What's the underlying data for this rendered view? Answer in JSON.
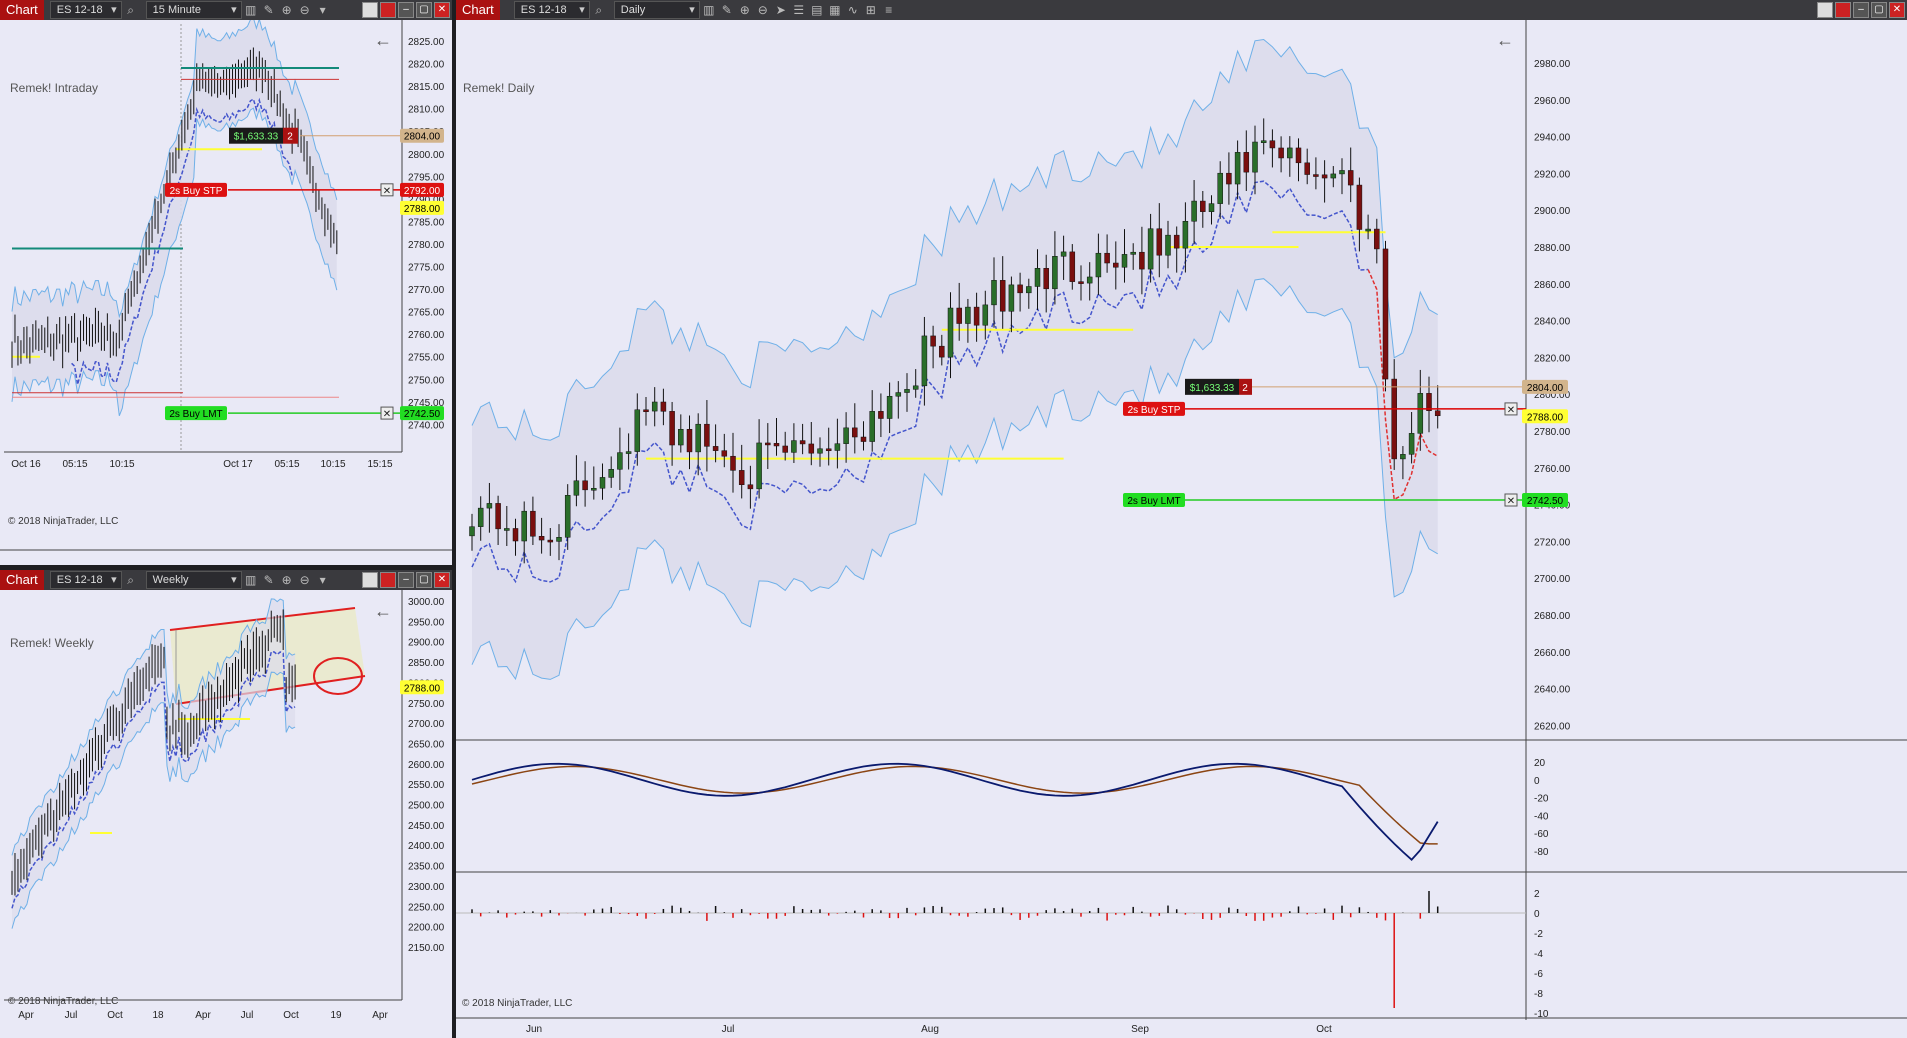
{
  "colors": {
    "down": "#7a0f0f",
    "up": "#2a6e2a",
    "band": "#6fb0e8",
    "accent_red": "#c00",
    "lmt_green": "#2c2",
    "price_tag": "#ffff33",
    "target_tag": "#d2b48c"
  },
  "common": {
    "chart_label": "Chart",
    "symbol": "ES 12-18",
    "copyright": "© 2018 NinjaTrader, LLC"
  },
  "intraday": {
    "timeframe": "15 Minute",
    "watermark": "Remek! Intraday",
    "price_labels": [
      "2825.00",
      "2820.00",
      "2815.00",
      "2810.00",
      "2805.00",
      "2800.00",
      "2795.00",
      "2790.00",
      "2785.00",
      "2780.00",
      "2775.00",
      "2770.00",
      "2765.00",
      "2760.00",
      "2755.00",
      "2750.00",
      "2745.00",
      "2740.00"
    ],
    "time_labels": [
      "Oct 16",
      "05:15",
      "10:15",
      "Oct 17",
      "05:15",
      "10:15",
      "15:15"
    ],
    "pnl": "$1,633.33",
    "pnl_qty": "2",
    "tag_target": "2804.00",
    "tag_stp": "2792.00",
    "tag_last": "2788.00",
    "tag_lmt": "2742.50",
    "buy_stp": "2s  Buy STP",
    "buy_lmt": "2s  Buy LMT"
  },
  "weekly": {
    "timeframe": "Weekly",
    "watermark": "Remek! Weekly",
    "price_labels": [
      "3000.00",
      "2950.00",
      "2900.00",
      "2850.00",
      "2800.00",
      "2750.00",
      "2700.00",
      "2650.00",
      "2600.00",
      "2550.00",
      "2500.00",
      "2450.00",
      "2400.00",
      "2350.00",
      "2300.00",
      "2250.00",
      "2200.00",
      "2150.00"
    ],
    "time_labels": [
      "Apr",
      "Jul",
      "Oct",
      "18",
      "Apr",
      "Jul",
      "Oct",
      "19",
      "Apr"
    ],
    "tag_last": "2788.00"
  },
  "daily": {
    "timeframe": "Daily",
    "watermark": "Remek! Daily",
    "price_labels": [
      "2980.00",
      "2960.00",
      "2940.00",
      "2920.00",
      "2900.00",
      "2880.00",
      "2860.00",
      "2840.00",
      "2820.00",
      "2800.00",
      "2780.00",
      "2760.00",
      "2740.00",
      "2720.00",
      "2700.00",
      "2680.00",
      "2660.00",
      "2640.00",
      "2620.00"
    ],
    "time_labels": [
      "Jun",
      "Jul",
      "Aug",
      "Sep",
      "Oct"
    ],
    "osc_labels": [
      "20",
      "0",
      "-20",
      "-40",
      "-60",
      "-80"
    ],
    "hist_labels": [
      "2",
      "0",
      "-2",
      "-4",
      "-6",
      "-8",
      "-10"
    ],
    "pnl": "$1,633.33",
    "pnl_qty": "2",
    "tag_target": "2804.00",
    "tag_last": "2788.00",
    "tag_lmt": "2742.50",
    "buy_stp": "2s  Buy STP",
    "buy_lmt": "2s  Buy LMT"
  }
}
